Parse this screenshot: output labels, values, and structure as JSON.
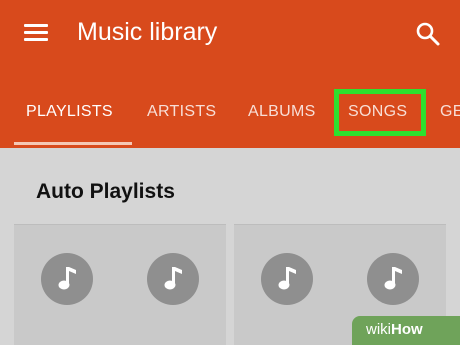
{
  "app_bar": {
    "title": "Music library",
    "menu_icon": "hamburger-menu-icon",
    "search_icon": "search-icon",
    "color": "#d84a1c"
  },
  "tabs": [
    {
      "label": "PLAYLISTS",
      "selected": true
    },
    {
      "label": "ARTISTS",
      "selected": false
    },
    {
      "label": "ALBUMS",
      "selected": false
    },
    {
      "label": "SONGS",
      "selected": false,
      "highlighted": true
    },
    {
      "label": "GE",
      "selected": false
    }
  ],
  "highlight_color": "#2ee02e",
  "section": {
    "title": "Auto Playlists"
  },
  "cards": [
    {
      "icons": [
        "music-note-icon",
        "music-note-icon"
      ]
    },
    {
      "icons": [
        "music-note-icon",
        "music-note-icon"
      ]
    }
  ],
  "watermark": {
    "prefix": "wiki",
    "suffix": "How",
    "color": "#6fa35a"
  }
}
